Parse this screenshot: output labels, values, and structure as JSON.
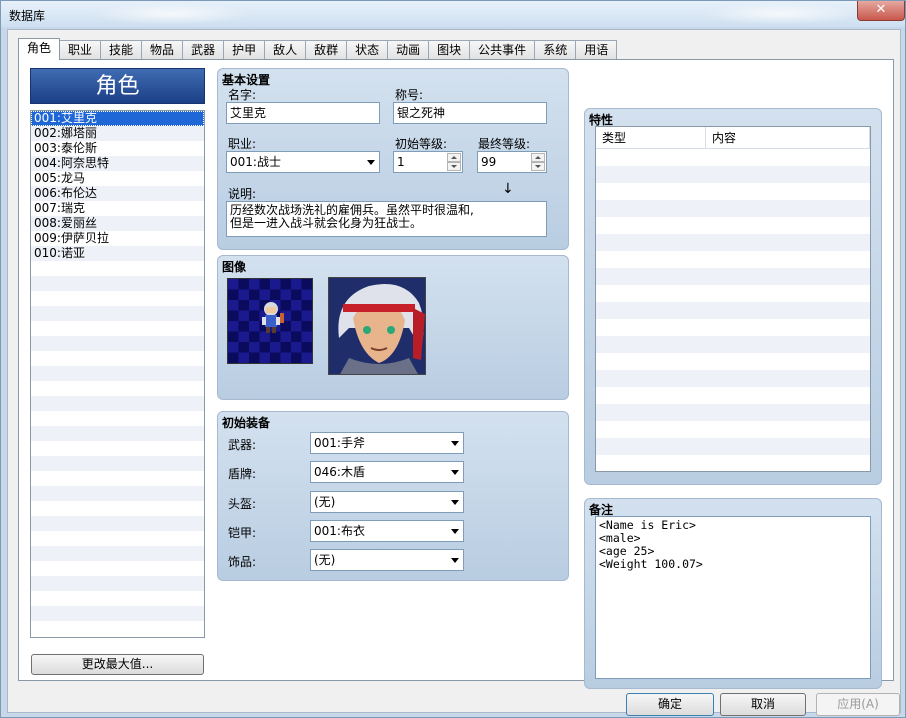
{
  "window": {
    "title": "数据库",
    "close_glyph": "✕"
  },
  "tabs": [
    {
      "label": "角色"
    },
    {
      "label": "职业"
    },
    {
      "label": "技能"
    },
    {
      "label": "物品"
    },
    {
      "label": "武器"
    },
    {
      "label": "护甲"
    },
    {
      "label": "敌人"
    },
    {
      "label": "敌群"
    },
    {
      "label": "状态"
    },
    {
      "label": "动画"
    },
    {
      "label": "图块"
    },
    {
      "label": "公共事件"
    },
    {
      "label": "系统"
    },
    {
      "label": "用语"
    }
  ],
  "active_tab": 0,
  "actor_list": {
    "header": "角色",
    "items": [
      {
        "label": "001:艾里克"
      },
      {
        "label": "002:娜塔丽"
      },
      {
        "label": "003:泰伦斯"
      },
      {
        "label": "004:阿奈思特"
      },
      {
        "label": "005:龙马"
      },
      {
        "label": "006:布伦达"
      },
      {
        "label": "007:瑞克"
      },
      {
        "label": "008:爱丽丝"
      },
      {
        "label": "009:伊萨贝拉"
      },
      {
        "label": "010:诺亚"
      }
    ],
    "selected_index": 0,
    "change_max_label": "更改最大值..."
  },
  "general": {
    "title": "基本设置",
    "name_label": "名字:",
    "name_value": "艾里克",
    "nickname_label": "称号:",
    "nickname_value": "银之死神",
    "class_label": "职业:",
    "class_value": "001:战士",
    "initial_level_label": "初始等级:",
    "initial_level_value": "1",
    "max_level_label": "最终等级:",
    "max_level_value": "99",
    "profile_label": "说明:",
    "profile_value": "历经数次战场洗礼的雇佣兵。虽然平时很温和,\n但是一进入战斗就会化身为狂战士。"
  },
  "images": {
    "title": "图像"
  },
  "equipment": {
    "title": "初始装备",
    "slots": [
      {
        "label": "武器:",
        "value": "001:手斧"
      },
      {
        "label": "盾牌:",
        "value": "046:木盾"
      },
      {
        "label": "头盔:",
        "value": "(无)"
      },
      {
        "label": "铠甲:",
        "value": "001:布衣"
      },
      {
        "label": "饰品:",
        "value": "(无)"
      }
    ]
  },
  "traits": {
    "title": "特性",
    "col_type": "类型",
    "col_content": "内容"
  },
  "note": {
    "title": "备注",
    "value": "<Name is Eric>\n<male>\n<age 25>\n<Weight 100.07>"
  },
  "footer": {
    "ok_label": "确定",
    "cancel_label": "取消",
    "apply_label": "应用(A)"
  },
  "colors": {
    "selection": "#1f66d6",
    "list_header": "#2a519b"
  }
}
